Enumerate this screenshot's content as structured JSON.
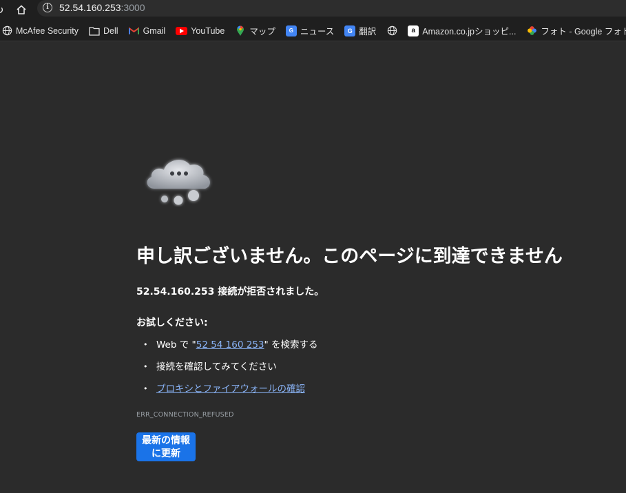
{
  "address_bar": {
    "host": "52.54.160.253",
    "port": ":3000"
  },
  "bookmarks": [
    {
      "label": "McAfee Security",
      "icon": "globe-icon"
    },
    {
      "label": "Dell",
      "icon": "folder-icon"
    },
    {
      "label": "Gmail",
      "icon": "gmail-icon"
    },
    {
      "label": "YouTube",
      "icon": "youtube-icon"
    },
    {
      "label": "マップ",
      "icon": "maps-icon"
    },
    {
      "label": "ニュース",
      "icon": "news-icon"
    },
    {
      "label": "翻訳",
      "icon": "translate-icon"
    },
    {
      "label": "",
      "icon": "globe-icon"
    },
    {
      "label": "Amazon.co.jpショッピ...",
      "icon": "amazon-icon"
    },
    {
      "label": "フォト - Google フォト",
      "icon": "photos-icon"
    }
  ],
  "error_page": {
    "title": "申し訳ございません。このページに到達できません",
    "subtitle": "52.54.160.253 接続が拒否されました。",
    "try_heading": "お試しください:",
    "suggestion_1_prefix": "Web で \"",
    "suggestion_1_link": "52 54 160 253",
    "suggestion_1_suffix": "\" を検索する",
    "suggestion_2": "接続を確認してみてください",
    "suggestion_3_link": "プロキシとファイアウォールの確認",
    "error_code": "ERR_CONNECTION_REFUSED",
    "reload_line1": "最新の情報",
    "reload_line2": "に更新"
  },
  "colors": {
    "background": "#2b2b2b",
    "link": "#8ab4f8",
    "button": "#1a73e8"
  }
}
